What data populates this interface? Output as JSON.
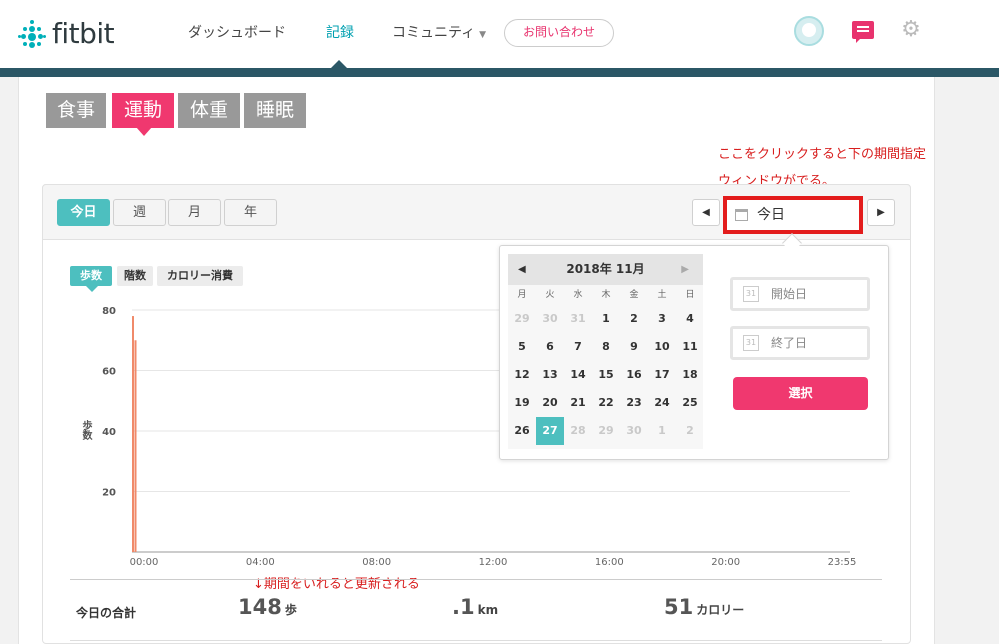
{
  "header": {
    "logo_text": "fitbit",
    "nav": [
      {
        "label": "ダッシュボード"
      },
      {
        "label": "記録"
      },
      {
        "label": "コミュニティ"
      }
    ],
    "contact_label": "お問い合わせ",
    "icons": [
      "avatar",
      "message-icon",
      "gear-icon"
    ]
  },
  "categories": [
    {
      "label": "食事"
    },
    {
      "label": "運動"
    },
    {
      "label": "体重"
    },
    {
      "label": "睡眠"
    }
  ],
  "annotation_top_1": "ここをクリックすると下の期間指定",
  "annotation_top_2": "ウィンドウがでる。",
  "periods": [
    {
      "label": "今日"
    },
    {
      "label": "週"
    },
    {
      "label": "月"
    },
    {
      "label": "年"
    }
  ],
  "date_input_value": "今日",
  "metrics": [
    {
      "label": "歩数"
    },
    {
      "label": "階数"
    },
    {
      "label": "カロリー消費"
    }
  ],
  "chart_data": {
    "type": "bar",
    "ylabel": "歩数",
    "ylim": [
      0,
      80
    ],
    "yticks": [
      "80",
      "60",
      "40",
      "20"
    ],
    "xticks": [
      "00:00",
      "04:00",
      "08:00",
      "12:00",
      "16:00",
      "20:00",
      "23:55"
    ],
    "x": [
      "00:00",
      "00:05"
    ],
    "values": [
      78,
      70
    ],
    "grid": true,
    "bar_color": "#f08a6a"
  },
  "annotation_mid": "↓期間をいれると更新される",
  "totals": {
    "label": "今日の合計",
    "steps_value": "148",
    "steps_unit": "歩",
    "distance_value": ".1",
    "distance_unit": "km",
    "calories_value": "51",
    "calories_unit": "カロリー"
  },
  "calendar": {
    "title": "2018年 11月",
    "weekdays": [
      "月",
      "火",
      "水",
      "木",
      "金",
      "土",
      "日"
    ],
    "weeks": [
      [
        "29",
        "30",
        "31",
        "1",
        "2",
        "3",
        "4"
      ],
      [
        "5",
        "6",
        "7",
        "8",
        "9",
        "10",
        "11"
      ],
      [
        "12",
        "13",
        "14",
        "15",
        "16",
        "17",
        "18"
      ],
      [
        "19",
        "20",
        "21",
        "22",
        "23",
        "24",
        "25"
      ],
      [
        "26",
        "27",
        "28",
        "29",
        "30",
        "1",
        "2"
      ]
    ],
    "selected": "27",
    "start_placeholder": "開始日",
    "end_placeholder": "終了日",
    "select_label": "選択",
    "range_icon_text": "31"
  },
  "colors": {
    "accent_pink": "#f0386f",
    "accent_teal": "#4dbfbf",
    "annotation_red": "#d81e1e"
  }
}
